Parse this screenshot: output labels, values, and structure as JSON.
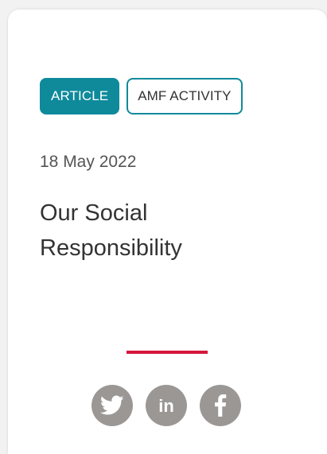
{
  "tags": [
    {
      "label": "ARTICLE"
    },
    {
      "label": "AMF ACTIVITY"
    }
  ],
  "date": "18 May 2022",
  "title": "Our Social Responsibility",
  "social": [
    {
      "icon": "twitter-icon"
    },
    {
      "icon": "linkedin-icon",
      "label": "in"
    },
    {
      "icon": "facebook-icon"
    }
  ],
  "colors": {
    "accent": "#0e8a9b",
    "divider": "#d6163d",
    "social_bg": "#9b9795"
  }
}
